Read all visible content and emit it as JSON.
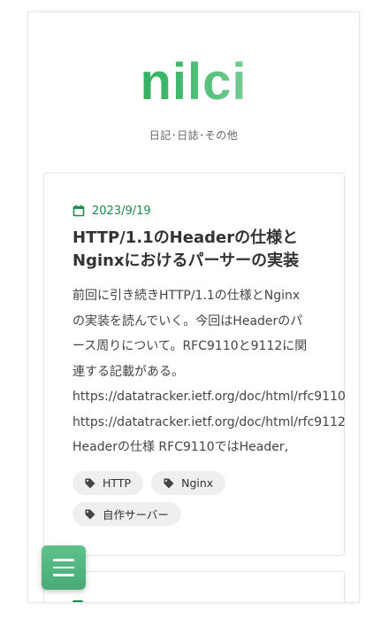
{
  "site": {
    "title": "nilci",
    "subtitle": "日記･日誌･その他"
  },
  "post": {
    "date": "2023/9/19",
    "title": "HTTP/1.1のHeaderの仕様とNginxにおけるパーサーの実装",
    "excerpt": "前回に引き続きHTTP/1.1の仕様とNginx\nの実装を読んでいく。今回はHeaderのパ\nース周りについて。RFC9110と9112に関\n連する記載がある。\nhttps://datatracker.ietf.org/doc/html/rfc9110\nhttps://datatracker.ietf.org/doc/html/rfc9112\nHeaderの仕様 RFC9110ではHeader,",
    "tags": [
      "HTTP",
      "Nginx",
      "自作サーバー"
    ]
  },
  "icons": {
    "date": "calendar-icon",
    "tag": "tag-icon",
    "menu": "hamburger-menu-icon"
  },
  "colors": {
    "accent": "#1e8a4c",
    "menu_button": "#4aab78",
    "tag_bg": "#efefef"
  }
}
